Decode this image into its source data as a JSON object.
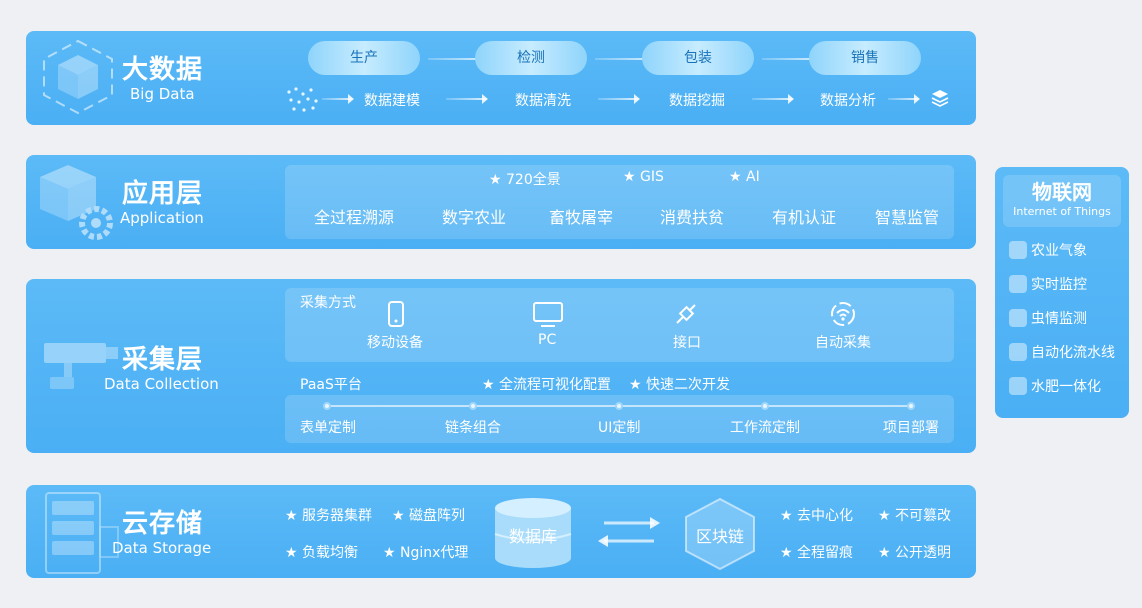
{
  "big_data": {
    "title": "大数据",
    "subtitle": "Big Data",
    "flow": [
      "生产",
      "检测",
      "包装",
      "销售"
    ],
    "steps": [
      "数据建模",
      "数据清洗",
      "数据挖掘",
      "数据分析"
    ]
  },
  "application": {
    "title": "应用层",
    "subtitle": "Application",
    "features": [
      "720全景",
      "GIS",
      "AI"
    ],
    "items": [
      "全过程溯源",
      "数字农业",
      "畜牧屠宰",
      "消费扶贫",
      "有机认证",
      "智慧监管"
    ]
  },
  "collection": {
    "title": "采集层",
    "subtitle": "Data Collection",
    "methods_label": "采集方式",
    "methods": [
      "移动设备",
      "PC",
      "接口",
      "自动采集"
    ],
    "paas_label": "PaaS平台",
    "paas_features": [
      "全流程可视化配置",
      "快速二次开发"
    ],
    "paas_steps": [
      "表单定制",
      "链条组合",
      "UI定制",
      "工作流定制",
      "项目部署"
    ]
  },
  "storage": {
    "title": "云存储",
    "subtitle": "Data Storage",
    "left_features": [
      "服务器集群",
      "磁盘阵列",
      "负载均衡",
      "Nginx代理"
    ],
    "database": "数据库",
    "blockchain": "区块链",
    "right_features": [
      "去中心化",
      "不可篡改",
      "全程留痕",
      "公开透明"
    ]
  },
  "iot": {
    "title": "物联网",
    "subtitle": "Internet of Things",
    "items": [
      "农业气象",
      "实时监控",
      "虫情监测",
      "自动化流水线",
      "水肥一体化"
    ]
  }
}
